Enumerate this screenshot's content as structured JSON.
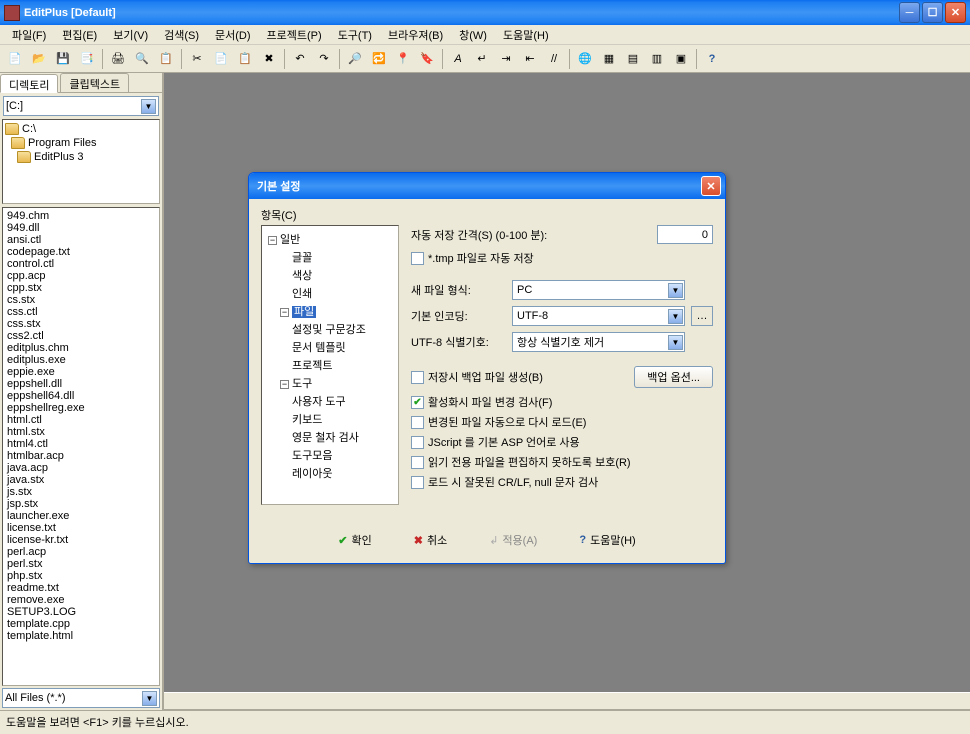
{
  "window": {
    "title": "EditPlus  [Default]"
  },
  "menu": {
    "file": "파일(F)",
    "edit": "편집(E)",
    "view": "보기(V)",
    "search": "검색(S)",
    "doc": "문서(D)",
    "project": "프로젝트(P)",
    "tools": "도구(T)",
    "browser": "브라우져(B)",
    "window": "창(W)",
    "help": "도움말(H)"
  },
  "sidebar": {
    "tab_dir": "디렉토리",
    "tab_clip": "클립텍스트",
    "drive": "[C:]",
    "folders": [
      "C:\\",
      "Program Files",
      "EditPlus 3"
    ],
    "files": [
      "949.chm",
      "949.dll",
      "ansi.ctl",
      "codepage.txt",
      "control.ctl",
      "cpp.acp",
      "cpp.stx",
      "cs.stx",
      "css.ctl",
      "css.stx",
      "css2.ctl",
      "editplus.chm",
      "editplus.exe",
      "eppie.exe",
      "eppshell.dll",
      "eppshell64.dll",
      "eppshellreg.exe",
      "html.ctl",
      "html.stx",
      "html4.ctl",
      "htmlbar.acp",
      "java.acp",
      "java.stx",
      "js.stx",
      "jsp.stx",
      "launcher.exe",
      "license.txt",
      "license-kr.txt",
      "perl.acp",
      "perl.stx",
      "php.stx",
      "readme.txt",
      "remove.exe",
      "SETUP3.LOG",
      "template.cpp",
      "template.html"
    ],
    "filter": "All Files (*.*)"
  },
  "dialog": {
    "title": "기본 설정",
    "category_label": "항목(C)",
    "tree": {
      "general": "일반",
      "font": "글꼴",
      "color": "색상",
      "print": "인쇄",
      "file": "파일",
      "syntax": "설정및 구문강조",
      "template": "문서 템플릿",
      "project": "프로젝트",
      "tools": "도구",
      "usertools": "사용자 도구",
      "keyboard": "키보드",
      "spell": "영문 철자 검사",
      "toolbar": "도구모음",
      "layout": "레이아웃"
    },
    "settings": {
      "autosave_label": "자동 저장 간격(S) (0-100 분):",
      "autosave_value": "0",
      "tmp_save": "*.tmp 파일로 자동 저장",
      "newfile_label": "새 파일 형식:",
      "newfile_value": "PC",
      "encoding_label": "기본 인코딩:",
      "encoding_value": "UTF-8",
      "utf8sig_label": "UTF-8 식별기호:",
      "utf8sig_value": "항상 식별기호 제거",
      "backup": "저장시 백업 파일 생성(B)",
      "backup_btn": "백업 옵션...",
      "detect_change": "활성화시 파일 변경 검사(F)",
      "auto_reload": "변경된 파일 자동으로 다시 로드(E)",
      "jscript_asp": "JScript 를 기본 ASP 언어로 사용",
      "readonly_protect": "읽기 전용 파일을 편집하지 못하도록 보호(R)",
      "crlf_check": "로드 시 잘못된 CR/LF, null 문자 검사"
    },
    "buttons": {
      "ok": "확인",
      "cancel": "취소",
      "apply": "적용(A)",
      "help": "도움말(H)"
    }
  },
  "status": "도움말을 보려면 <F1> 키를 누르십시오."
}
